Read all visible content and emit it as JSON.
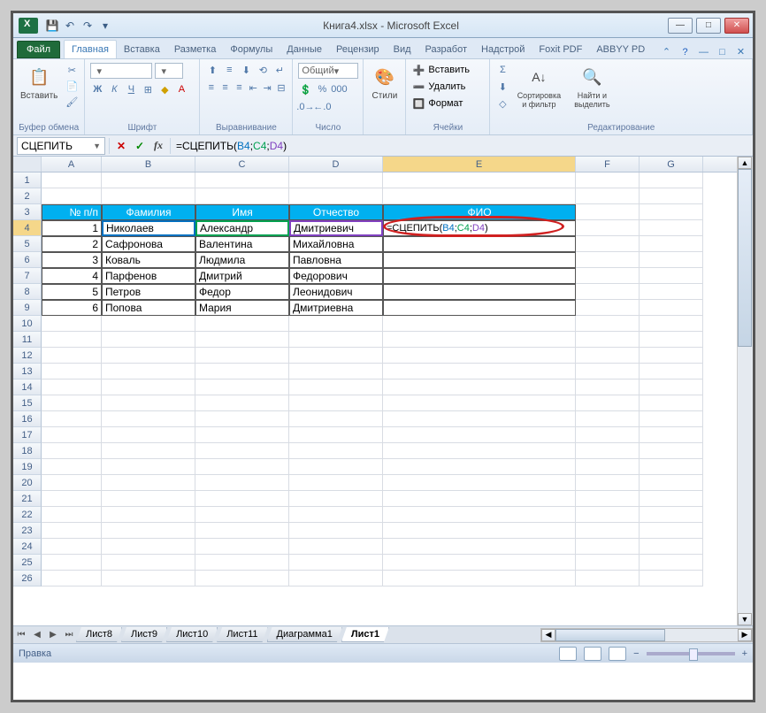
{
  "titlebar": {
    "title": "Книга4.xlsx - Microsoft Excel"
  },
  "ribbon": {
    "tabs": {
      "file": "Файл",
      "home": "Главная",
      "insert": "Вставка",
      "layout": "Разметка",
      "formulas": "Формулы",
      "data": "Данные",
      "review": "Рецензир",
      "view": "Вид",
      "developer": "Разработ",
      "addins": "Надстрой",
      "foxit": "Foxit PDF",
      "abbyy": "ABBYY PD"
    },
    "groups": {
      "clipboard": {
        "paste": "Вставить",
        "label": "Буфер обмена"
      },
      "font": {
        "label": "Шрифт"
      },
      "alignment": {
        "label": "Выравнивание"
      },
      "number": {
        "format": "Общий",
        "label": "Число"
      },
      "styles": {
        "styles": "Стили"
      },
      "cells": {
        "insert": "Вставить",
        "delete": "Удалить",
        "format": "Формат",
        "label": "Ячейки"
      },
      "editing": {
        "sort": "Сортировка и фильтр",
        "find": "Найти и выделить",
        "label": "Редактирование"
      }
    }
  },
  "formula_bar": {
    "name_box": "СЦЕПИТЬ",
    "formula_prefix": "=СЦЕПИТЬ(",
    "ref1": "B4",
    "sep": ";",
    "ref2": "C4",
    "ref3": "D4",
    "suffix": ")"
  },
  "grid": {
    "cols": [
      "A",
      "B",
      "C",
      "D",
      "E",
      "F",
      "G"
    ],
    "headers": {
      "num": "№ п/п",
      "surname": "Фамилия",
      "name": "Имя",
      "patronymic": "Отчество",
      "fio": "ФИО"
    },
    "rows": [
      {
        "n": "1",
        "surname": "Николаев",
        "name": "Александр",
        "patronymic": "Дмитриевич"
      },
      {
        "n": "2",
        "surname": "Сафронова",
        "name": "Валентина",
        "patronymic": "Михайловна"
      },
      {
        "n": "3",
        "surname": "Коваль",
        "name": "Людмила",
        "patronymic": "Павловна"
      },
      {
        "n": "4",
        "surname": "Парфенов",
        "name": "Дмитрий",
        "patronymic": "Федорович"
      },
      {
        "n": "5",
        "surname": "Петров",
        "name": "Федор",
        "patronymic": "Леонидович"
      },
      {
        "n": "6",
        "surname": "Попова",
        "name": "Мария",
        "patronymic": "Дмитриевна"
      }
    ],
    "e4_formula": {
      "prefix": "=СЦЕПИТЬ(",
      "r1": "B4",
      "s": ";",
      "r2": "C4",
      "r3": "D4",
      "suffix": ")"
    }
  },
  "sheets": {
    "s8": "Лист8",
    "s9": "Лист9",
    "s10": "Лист10",
    "s11": "Лист11",
    "diag": "Диаграмма1",
    "s1": "Лист1"
  },
  "status": {
    "mode": "Правка"
  }
}
